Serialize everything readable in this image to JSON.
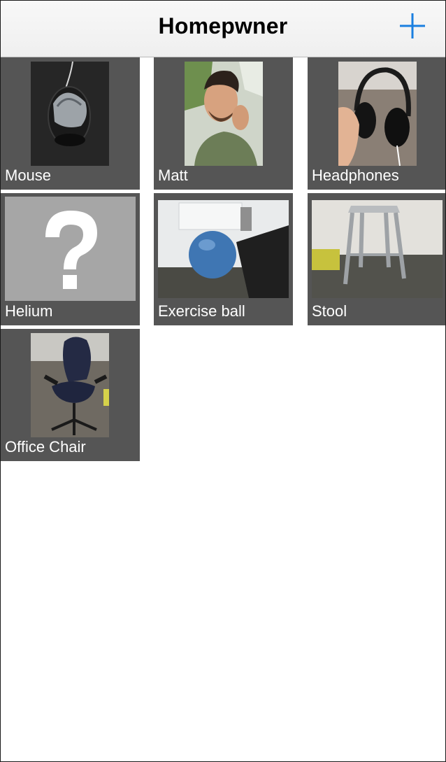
{
  "nav": {
    "title": "Homepwner",
    "add_icon": "plus-icon",
    "accent_color": "#1a7fe0"
  },
  "items": [
    {
      "label": "Mouse",
      "image": "photo-mouse"
    },
    {
      "label": "Matt",
      "image": "photo-person"
    },
    {
      "label": "Headphones",
      "image": "photo-headphones"
    },
    {
      "label": "Helium",
      "image": "placeholder-question-icon"
    },
    {
      "label": "Exercise ball",
      "image": "photo-exercise-ball"
    },
    {
      "label": "Stool",
      "image": "photo-stool"
    },
    {
      "label": "Office Chair",
      "image": "photo-office-chair"
    }
  ]
}
